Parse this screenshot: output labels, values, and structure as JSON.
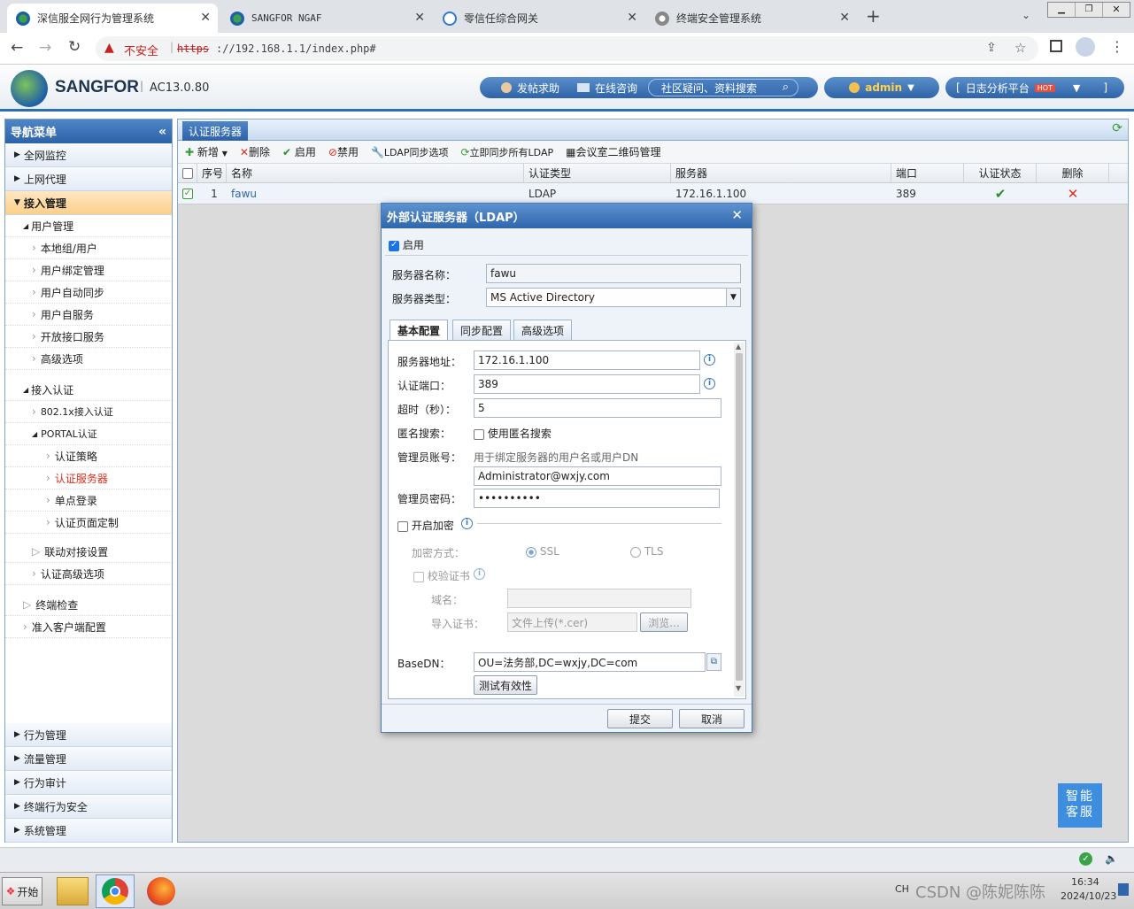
{
  "browser": {
    "tabs": [
      {
        "title": "深信服全网行为管理系统"
      },
      {
        "title": "SANGFOR NGAF"
      },
      {
        "title": "零信任综合网关"
      },
      {
        "title": "终端安全管理系统"
      }
    ],
    "insecure_label": "不安全",
    "url_scheme": "https",
    "url_rest": "://192.168.1.1/index.php#"
  },
  "header": {
    "brand": "SANGFOR",
    "version": "AC13.0.80",
    "help_post": "发帖求助",
    "online_consult": "在线咨询",
    "community_search": "社区疑问、资料搜索",
    "user": "admin",
    "log_platform": "日志分析平台",
    "hot_badge": "HOT"
  },
  "sidebar": {
    "title": "导航菜单",
    "top_sections": [
      "全网监控",
      "上网代理",
      "接入管理"
    ],
    "user_mgmt_title": "用户管理",
    "user_mgmt_items": [
      "本地组/用户",
      "用户绑定管理",
      "用户自动同步",
      "用户自服务",
      "开放接口服务",
      "高级选项"
    ],
    "access_auth_title": "接入认证",
    "access_auth_items": [
      "802.1x接入认证",
      "PORTAL认证"
    ],
    "portal_items": [
      "认证策略",
      "认证服务器",
      "单点登录",
      "认证页面定制"
    ],
    "other_items": [
      "联动对接设置",
      "认证高级选项"
    ],
    "terminal_items": [
      "终端检查",
      "准入客户端配置"
    ],
    "bottom_sections": [
      "行为管理",
      "流量管理",
      "行为审计",
      "终端行为安全",
      "系统管理"
    ]
  },
  "main": {
    "tab": "认证服务器",
    "toolbar": {
      "add": "新增",
      "delete": "删除",
      "enable": "启用",
      "disable": "禁用",
      "ldap_sync": "LDAP同步选项",
      "sync_all": "立即同步所有LDAP",
      "qrcode": "会议室二维码管理"
    },
    "columns": [
      "序号",
      "名称",
      "认证类型",
      "服务器",
      "端口",
      "认证状态",
      "删除"
    ],
    "rows": [
      {
        "index": "1",
        "name": "fawu",
        "type": "LDAP",
        "server": "172.16.1.100",
        "port": "389"
      }
    ]
  },
  "modal": {
    "title": "外部认证服务器（LDAP）",
    "enable_label": "启用",
    "server_name_label": "服务器名称：",
    "server_name": "fawu",
    "server_type_label": "服务器类型：",
    "server_type": "MS Active Directory",
    "tabs": [
      "基本配置",
      "同步配置",
      "高级选项"
    ],
    "addr_label": "服务器地址：",
    "addr": "172.16.1.100",
    "port_label": "认证端口：",
    "port": "389",
    "timeout_label": "超时（秒）：",
    "timeout": "5",
    "anon_label": "匿名搜索：",
    "anon_check": "使用匿名搜索",
    "admin_label": "管理员账号：",
    "admin_hint": "用于绑定服务器的用户名或用户DN",
    "admin_value": "Administrator@wxjy.com",
    "pwd_label": "管理员密码：",
    "pwd_value": "••••••••••",
    "encrypt_label": "开启加密",
    "enc_method_label": "加密方式：",
    "ssl": "SSL",
    "tls": "TLS",
    "verify_cert": "校验证书",
    "domain_label": "域名：",
    "import_cert_label": "导入证书：",
    "import_placeholder": "文件上传(*.cer)",
    "browse": "浏览...",
    "basedn_label": "BaseDN：",
    "basedn": "OU=法务部,DC=wxjy,DC=com",
    "test": "测试有效性",
    "submit": "提交",
    "cancel": "取消"
  },
  "assistant": {
    "line1": "智能",
    "line2": "客服"
  },
  "taskbar": {
    "start": "开始",
    "ime": "CH",
    "time": "16:34",
    "date": "2024/10/23",
    "watermark": "CSDN @陈妮陈陈"
  },
  "colors": {
    "accent": "#2f65ab",
    "active_red": "#d7301f",
    "check_green": "#2e8b2e"
  }
}
